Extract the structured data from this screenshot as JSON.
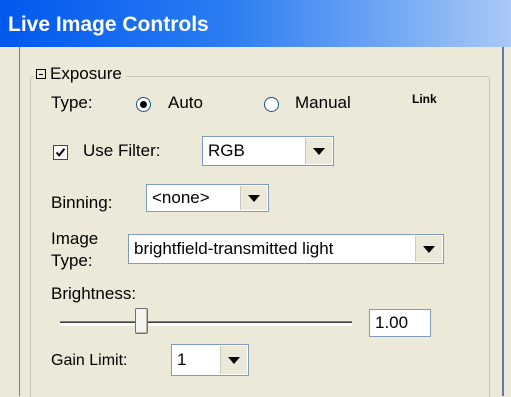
{
  "window": {
    "title": "Live Image Controls"
  },
  "exposure": {
    "group_label": "Exposure",
    "type_label": "Type:",
    "type_options": [
      {
        "label": "Auto",
        "selected": true
      },
      {
        "label": "Manual",
        "selected": false
      }
    ],
    "link_label": "Link",
    "use_filter_label": "Use Filter:",
    "use_filter_checked": true,
    "filter_value": "RGB",
    "binning_label": "Binning:",
    "binning_value": "<none>",
    "image_type_label_line1": "Image",
    "image_type_label_line2": "Type:",
    "image_type_value": "brightfield-transmitted light",
    "brightness_label": "Brightness:",
    "brightness_value": "1.00",
    "brightness_slider_fraction": 0.28,
    "gain_limit_label": "Gain Limit:",
    "gain_limit_value": "1"
  },
  "colors": {
    "titlebar": "#0058ee",
    "background": "#ece9d8",
    "field_border": "#7f9db9"
  }
}
